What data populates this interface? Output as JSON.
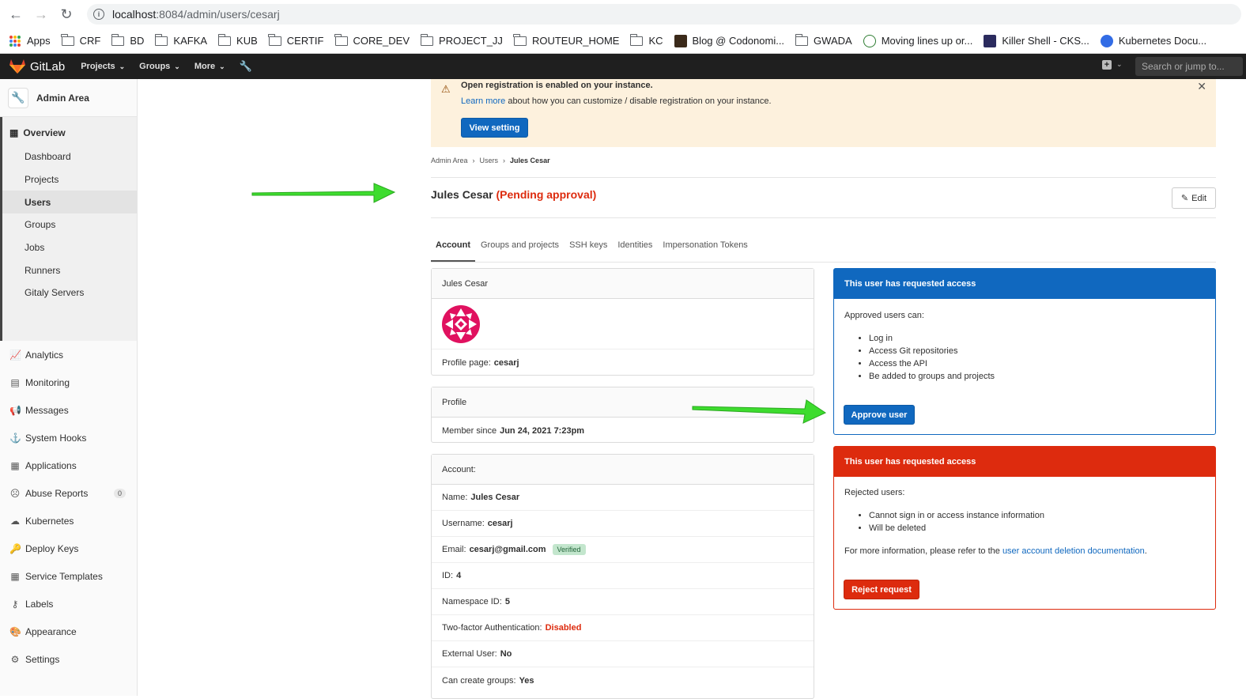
{
  "browser": {
    "url_host": "localhost",
    "url_path": ":8084/admin/users/cesarj",
    "bookmarks": [
      "Apps",
      "CRF",
      "BD",
      "KAFKA",
      "KUB",
      "CERTIF",
      "CORE_DEV",
      "PROJECT_JJ",
      "ROUTEUR_HOME",
      "KC",
      "Blog @ Codonomi...",
      "GWADA",
      "Moving lines up or...",
      "Killer Shell - CKS...",
      "Kubernetes Docu..."
    ]
  },
  "topbar": {
    "brand": "GitLab",
    "nav": [
      "Projects",
      "Groups",
      "More"
    ],
    "search_placeholder": "Search or jump to..."
  },
  "sidebar": {
    "title": "Admin Area",
    "overview": "Overview",
    "overview_items": [
      "Dashboard",
      "Projects",
      "Users",
      "Groups",
      "Jobs",
      "Runners",
      "Gitaly Servers"
    ],
    "active_item": "Users",
    "items": [
      "Analytics",
      "Monitoring",
      "Messages",
      "System Hooks",
      "Applications",
      "Abuse Reports",
      "Kubernetes",
      "Deploy Keys",
      "Service Templates",
      "Labels",
      "Appearance",
      "Settings"
    ],
    "abuse_count": "0"
  },
  "banner": {
    "title": "Open registration is enabled on your instance.",
    "link": "Learn more",
    "text": " about how you can customize / disable registration on your instance.",
    "button": "View setting"
  },
  "breadcrumb": [
    "Admin Area",
    "Users",
    "Jules Cesar"
  ],
  "user": {
    "name": "Jules Cesar",
    "status": "(Pending approval)",
    "edit": "Edit"
  },
  "tabs": [
    "Account",
    "Groups and projects",
    "SSH keys",
    "Identities",
    "Impersonation Tokens"
  ],
  "profile_card": {
    "name": "Jules Cesar",
    "profile_label": "Profile page:",
    "profile_value": "cesarj"
  },
  "profile2": {
    "title": "Profile",
    "member_label": "Member since",
    "member_value": "Jun 24, 2021 7:23pm"
  },
  "account": {
    "title": "Account:",
    "rows": [
      {
        "label": "Name:",
        "value": "Jules Cesar"
      },
      {
        "label": "Username:",
        "value": "cesarj"
      },
      {
        "label": "Email:",
        "value": "cesarj@gmail.com"
      },
      {
        "label": "ID:",
        "value": "4"
      },
      {
        "label": "Namespace ID:",
        "value": "5"
      },
      {
        "label": "Two-factor Authentication:",
        "value": "Disabled"
      },
      {
        "label": "External User:",
        "value": "No"
      },
      {
        "label": "Can create groups:",
        "value": "Yes"
      }
    ],
    "verified": "Verified"
  },
  "approve_panel": {
    "header": "This user has requested access",
    "intro": "Approved users can:",
    "items": [
      "Log in",
      "Access Git repositories",
      "Access the API",
      "Be added to groups and projects"
    ],
    "button": "Approve user"
  },
  "reject_panel": {
    "header": "This user has requested access",
    "intro": "Rejected users:",
    "items": [
      "Cannot sign in or access instance information",
      "Will be deleted"
    ],
    "more_prefix": "For more information, please refer to the ",
    "more_link": "user account deletion documentation",
    "more_suffix": ".",
    "button": "Reject request"
  },
  "colors": {
    "gitlab_blue": "#1068bf",
    "danger_red": "#dd2b0e",
    "arrow_green": "#3ddc2e",
    "banner_bg": "#fdf1dd"
  }
}
